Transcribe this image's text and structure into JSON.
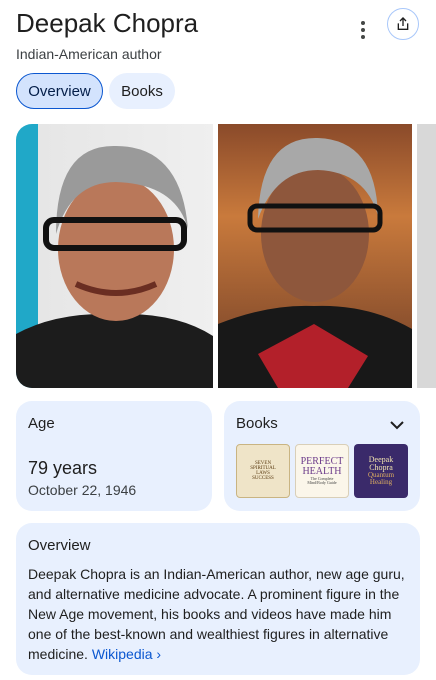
{
  "header": {
    "title": "Deepak Chopra",
    "subtitle": "Indian-American author",
    "more_icon": "more-vertical-icon",
    "share_icon": "share-icon"
  },
  "tabs": [
    {
      "label": "Overview",
      "selected": true
    },
    {
      "label": "Books",
      "selected": false
    }
  ],
  "images": [
    {
      "alt": "photo 1"
    },
    {
      "alt": "photo 2"
    },
    {
      "alt": "photo 3 (partial)"
    }
  ],
  "age_card": {
    "label": "Age",
    "value": "79 years",
    "date": "October 22, 1946"
  },
  "books_card": {
    "label": "Books",
    "chevron_icon": "chevron-down-icon",
    "covers": [
      {
        "lines": [
          "SEVEN",
          "SPIRITUAL",
          "LAWS",
          "SUCCESS"
        ]
      },
      {
        "lines": [
          "PERFECT",
          "HEALTH",
          "The Complete",
          "Mind/Body Guide"
        ]
      },
      {
        "lines": [
          "Deepak",
          "Chopra",
          "Quantum",
          "Healing"
        ]
      }
    ]
  },
  "overview_card": {
    "label": "Overview",
    "text": "Deepak Chopra is an Indian-American author, new age guru, and alternative medicine advocate. A prominent figure in the New Age movement, his books and videos have made him one of the best-known and wealthiest figures in alternative medicine.",
    "link_label": "Wikipedia",
    "link_chevron": "›"
  },
  "colors": {
    "card_bg": "#e8f0fe",
    "tab_selected_bg": "#d3e3fd",
    "tab_selected_border": "#0b57d0",
    "link": "#0b57d0"
  }
}
